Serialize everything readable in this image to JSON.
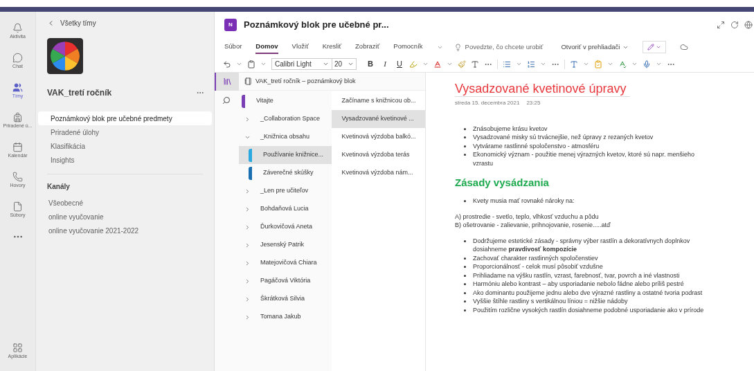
{
  "rail": {
    "items": [
      {
        "kind": "bell",
        "label": "Aktivita",
        "selected": false
      },
      {
        "kind": "chat",
        "label": "Chat",
        "selected": false
      },
      {
        "kind": "teams",
        "label": "Tímy",
        "selected": true
      },
      {
        "kind": "backpack",
        "label": "Priradené ú...",
        "selected": false
      },
      {
        "kind": "calendar",
        "label": "Kalendár",
        "selected": false
      },
      {
        "kind": "phone",
        "label": "Hovory",
        "selected": false
      },
      {
        "kind": "file",
        "label": "Súbory",
        "selected": false
      }
    ],
    "apps": {
      "label": "Aplikácie"
    }
  },
  "team_panel": {
    "back": "Všetky tímy",
    "team_name": "VAK_tretí ročník",
    "tabs": [
      {
        "label": "Poznámkový blok pre učebné predmety",
        "selected": true
      },
      {
        "label": "Priradené úlohy",
        "selected": false
      },
      {
        "label": "Klasifikácia",
        "selected": false
      },
      {
        "label": "Insights",
        "selected": false
      }
    ],
    "channels_heading": "Kanály",
    "channels": [
      {
        "label": "Všeobecné"
      },
      {
        "label": "online vyučovanie"
      },
      {
        "label": "online vyučovanie 2021-2022"
      }
    ]
  },
  "app": {
    "title": "Poznámkový blok pre učebné pr...",
    "icon_text": "N"
  },
  "ribbon": {
    "tabs": [
      {
        "label": "Súbor",
        "selected": false
      },
      {
        "label": "Domov",
        "selected": true
      },
      {
        "label": "Vložiť",
        "selected": false
      },
      {
        "label": "Kresliť",
        "selected": false
      },
      {
        "label": "Zobraziť",
        "selected": false
      },
      {
        "label": "Pomocník",
        "selected": false
      }
    ],
    "search_placeholder": "Povedzte, čo chcete urobiť",
    "open_in_browser": "Otvoriť v prehliadači",
    "font": "Calibri Light",
    "size": "20",
    "bold": "B",
    "italic": "I",
    "underline": "U"
  },
  "notebook": {
    "title": "VAK_tretí ročník – poznámkový blok",
    "sections": [
      {
        "label": "Vitajte",
        "kind": "section",
        "color": "#7b3fb5",
        "selected": false
      },
      {
        "label": "_Collaboration Space",
        "kind": "group",
        "expanded": false
      },
      {
        "label": "_Knižnica obsahu",
        "kind": "group",
        "expanded": true,
        "children": [
          {
            "label": "Používanie knižnice...",
            "kind": "section",
            "color": "#2aa9e0",
            "selected": true
          },
          {
            "label": "Záverečné skúšky",
            "kind": "section",
            "color": "#1a6fb0",
            "selected": false
          }
        ]
      },
      {
        "label": "_Len pre učiteľov",
        "kind": "group",
        "expanded": false
      },
      {
        "label": "Bohdaňová Lucia",
        "kind": "group",
        "expanded": false
      },
      {
        "label": "Ďurkovičová Aneta",
        "kind": "group",
        "expanded": false
      },
      {
        "label": "Jesenský Patrik",
        "kind": "group",
        "expanded": false
      },
      {
        "label": "Matejovičová Chiara",
        "kind": "group",
        "expanded": false
      },
      {
        "label": "Pagáčová Viktória",
        "kind": "group",
        "expanded": false
      },
      {
        "label": "Škrátková Silvia",
        "kind": "group",
        "expanded": false
      },
      {
        "label": "Tomana Jakub",
        "kind": "group",
        "expanded": false
      }
    ],
    "pages": [
      {
        "label": "Začíname s knižnicou ob...",
        "selected": false
      },
      {
        "label": "Vysadzované kvetinové ...",
        "selected": true
      },
      {
        "label": "Kvetinová výzdoba balkó...",
        "selected": false
      },
      {
        "label": "Kvetinová výzdoba terás",
        "selected": false
      },
      {
        "label": "Kvetinová výzdoba nám...",
        "selected": false
      }
    ]
  },
  "page": {
    "title": "Vysadzované kvetinové úpravy",
    "date": "streda 15. decembra 2021",
    "time": "23:25",
    "blocks": [
      {
        "kind": "bullets",
        "items": [
          "Znásobujeme krásu kvetov",
          "Vysadzované misky sú trvácnejšie, než úpravy z rezaných kvetov",
          "Vytvárame rastlinné spoločenstvo - atmosféru",
          "Ekonomický význam - použitie menej výrazných kvetov, ktoré sú napr. menšieho vzrastu"
        ]
      },
      {
        "kind": "heading",
        "text": "Zásady vysádzania"
      },
      {
        "kind": "bullets",
        "items": [
          "Kvety musia mať rovnaké nároky na:"
        ]
      },
      {
        "kind": "lines",
        "items": [
          "A) prostredie  - svetlo, teplo, vlhkosť vzduchu a pôdu",
          "B) ošetrovanie - zalievanie, prihnojovanie, rosenie.....atď"
        ]
      },
      {
        "kind": "bullets",
        "items": [
          "Dodržujeme estetické zásady - správny výber rastlín a dekoratívnych doplnkov dosiahneme **pravdivosť kompozície**",
          "Zachovať charakter rastlinných spoločenstiev",
          "Proporcionálnosť - celok musí pôsobiť vzdušne",
          "Prihliadame na výšku rastlín, vzrast, farebnosť, tvar, povrch a iné vlastnosti",
          "Harmóniu alebo kontrast – aby usporiadanie nebolo fádne alebo príliš pestré",
          "Ako dominantu použijeme jednu alebo dve výrazné rastliny a ostatné tvoria podrast",
          "Vyššie štíhle rastliny s vertikálnou líniou = nižšie nádoby",
          "Použitím rozlične vysokých rastlín dosiahneme podobné usporiadanie ako v prírode"
        ]
      }
    ]
  }
}
